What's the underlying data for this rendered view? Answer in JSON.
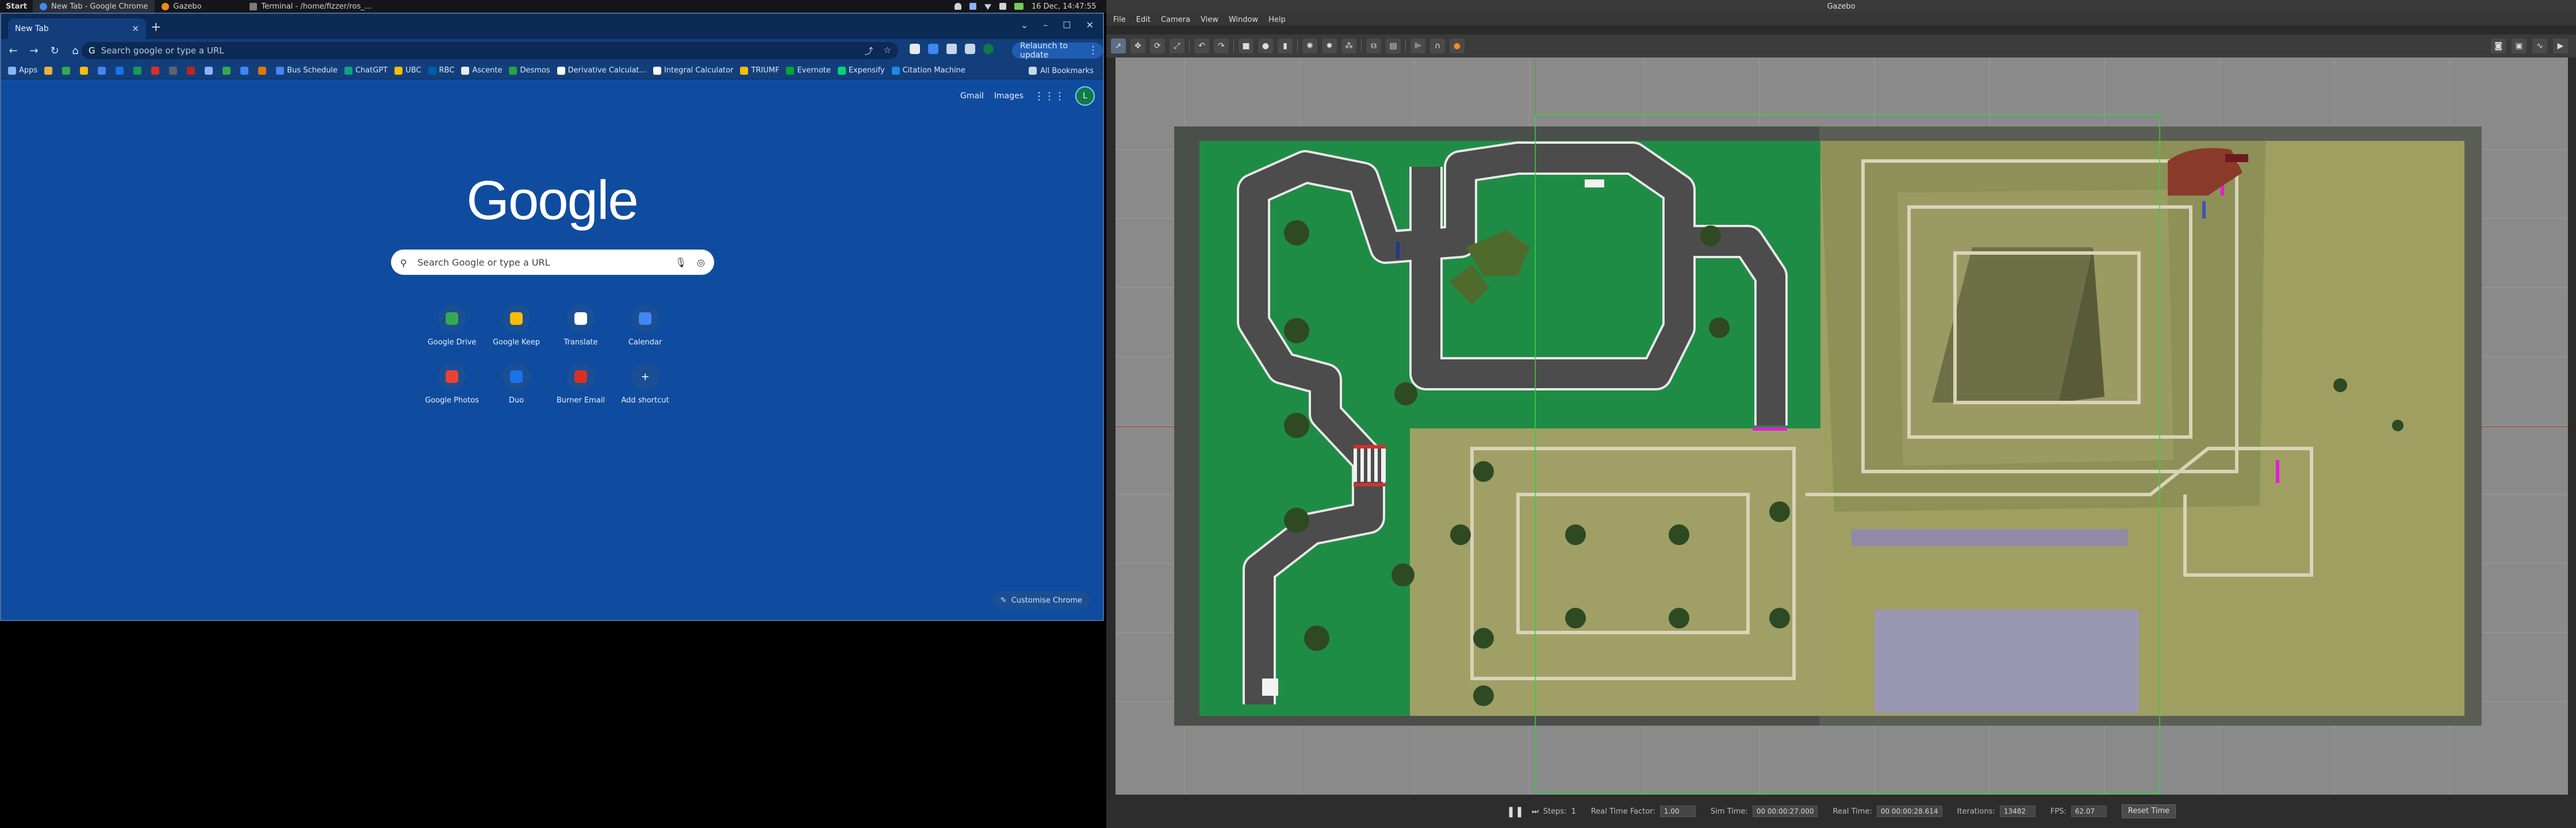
{
  "taskbar": {
    "start": "Start",
    "items": [
      {
        "label": "New Tab - Google Chrome",
        "color": "#4285f4"
      },
      {
        "label": "Gazebo",
        "color": "#f28c1a"
      },
      {
        "label": "Terminal - /home/fizzer/ros_...",
        "color": "#7a7a7a"
      }
    ],
    "clock": "16 Dec, 14:47:55"
  },
  "chrome": {
    "tab_title": "New Tab",
    "omnibox_placeholder": "Search google or type a URL",
    "relaunch_label": "Relaunch to update",
    "bookmarks": [
      {
        "label": "Apps",
        "color": "#8ab4f8"
      },
      {
        "label": "",
        "color": "#e8b339"
      },
      {
        "label": "",
        "color": "#34a853"
      },
      {
        "label": "",
        "color": "#fbbc04"
      },
      {
        "label": "",
        "color": "#4285f4"
      },
      {
        "label": "",
        "color": "#1a73e8"
      },
      {
        "label": "",
        "color": "#0f9d58"
      },
      {
        "label": "",
        "color": "#d93025"
      },
      {
        "label": "",
        "color": "#5f6368"
      },
      {
        "label": "",
        "color": "#c5221f"
      },
      {
        "label": "",
        "color": "#8ab4f8"
      },
      {
        "label": "",
        "color": "#34a853"
      },
      {
        "label": "",
        "color": "#4285f4"
      },
      {
        "label": "",
        "color": "#e37400"
      },
      {
        "label": "Bus Schedule",
        "color": "#4285f4"
      },
      {
        "label": "ChatGPT",
        "color": "#10a37f"
      },
      {
        "label": "UBC",
        "color": "#fbbc04"
      },
      {
        "label": "RBC",
        "color": "#005daa"
      },
      {
        "label": "Ascente",
        "color": "#e8eaed"
      },
      {
        "label": "Desmos",
        "color": "#2f9e44"
      },
      {
        "label": "Derivative Calculat...",
        "color": "#ffffff"
      },
      {
        "label": "Integral Calculator",
        "color": "#ffffff"
      },
      {
        "label": "TRIUMF",
        "color": "#fbbc04"
      },
      {
        "label": "Evernote",
        "color": "#00a82d"
      },
      {
        "label": "Expensify",
        "color": "#03d47c"
      },
      {
        "label": "Citation Machine",
        "color": "#1e88e5"
      }
    ],
    "all_bookmarks": "All Bookmarks",
    "gmail": "Gmail",
    "images": "Images",
    "avatar_letter": "L",
    "logo": "Google",
    "search_placeholder": "Search Google or type a URL",
    "shortcuts": [
      {
        "label": "Google Drive",
        "color": "#34a853"
      },
      {
        "label": "Google Keep",
        "color": "#fbbc04"
      },
      {
        "label": "Translate",
        "color": "#ffffff"
      },
      {
        "label": "Calendar",
        "color": "#4285f4"
      },
      {
        "label": "Google Photos",
        "color": "#ea4335"
      },
      {
        "label": "Duo",
        "color": "#1a73e8"
      },
      {
        "label": "Burner Email",
        "color": "#d93025"
      },
      {
        "label": "Add shortcut",
        "color": "#1a4f94"
      }
    ],
    "customise": "Customise Chrome"
  },
  "gazebo": {
    "title": "Gazebo",
    "menu": [
      "File",
      "Edit",
      "Camera",
      "View",
      "Window",
      "Help"
    ],
    "bottom": {
      "steps_label": "Steps:",
      "steps_value": "1",
      "rtf_label": "Real Time Factor:",
      "rtf_value": "1.00",
      "simtime_label": "Sim Time:",
      "simtime_value": "00 00:00:27.000",
      "realtime_label": "Real Time:",
      "realtime_value": "00 00:00:28.614",
      "iterations_label": "Iterations:",
      "iterations_value": "13482",
      "fps_label": "FPS:",
      "fps_value": "62.07",
      "reset_label": "Reset Time"
    }
  }
}
